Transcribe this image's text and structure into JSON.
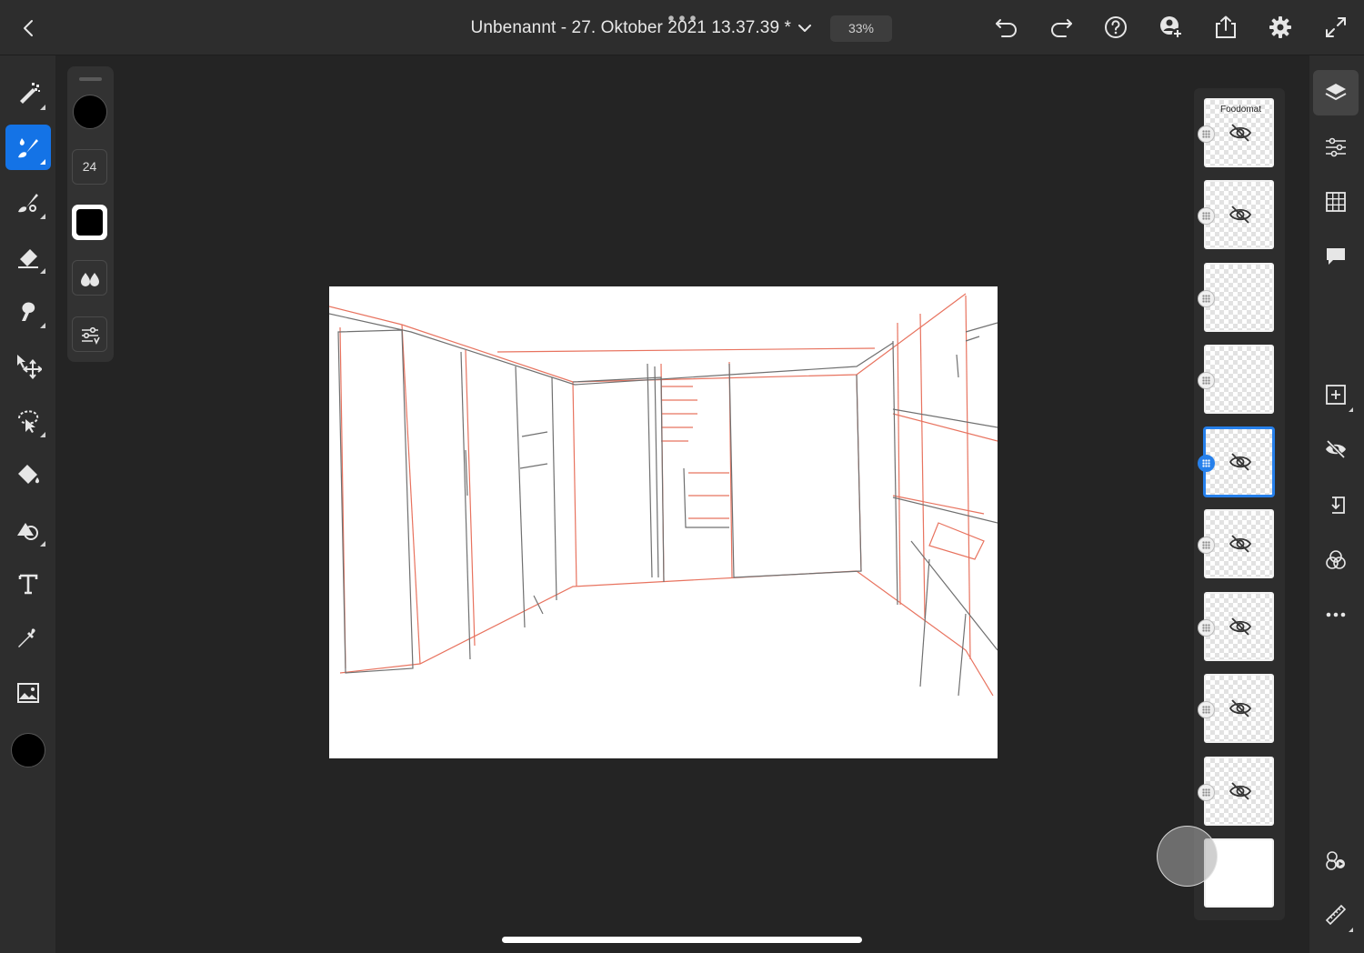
{
  "document": {
    "title": "Unbenannt - 27. Oktober 2021 13.37.39 *",
    "zoom": "33%"
  },
  "brush_panel": {
    "size": "24",
    "color": "#000000"
  },
  "toolbar": {
    "left_tools": [
      "pixel-brush",
      "live-brush",
      "vector-brush",
      "eraser",
      "smudge",
      "move",
      "selection",
      "fill",
      "shape",
      "text",
      "eyedropper",
      "image"
    ],
    "active_tool": "live-brush",
    "right_actions": [
      "undo",
      "redo",
      "help",
      "invite",
      "share",
      "settings",
      "fullscreen"
    ]
  },
  "layers": {
    "count": 10,
    "selected_index": 4,
    "thumb_label": "Foodomat",
    "items": [
      {
        "hidden": true
      },
      {
        "hidden": true
      },
      {
        "hidden": false
      },
      {
        "hidden": false
      },
      {
        "hidden": true,
        "selected": true
      },
      {
        "hidden": true
      },
      {
        "hidden": true
      },
      {
        "hidden": true
      },
      {
        "hidden": true
      },
      {
        "hidden": false,
        "background": true
      }
    ]
  },
  "right_rail": [
    "layers",
    "layer-properties",
    "grid",
    "comments",
    "add-layer",
    "hide-layer",
    "import",
    "blend-modes",
    "more",
    "livestream",
    "ruler"
  ],
  "colors": {
    "accent": "#1473e6",
    "selected_layer": "#2680eb",
    "background": "#242424",
    "panel": "#2d2d2d",
    "sketch_red": "#e8735f",
    "sketch_gray": "#707070"
  }
}
